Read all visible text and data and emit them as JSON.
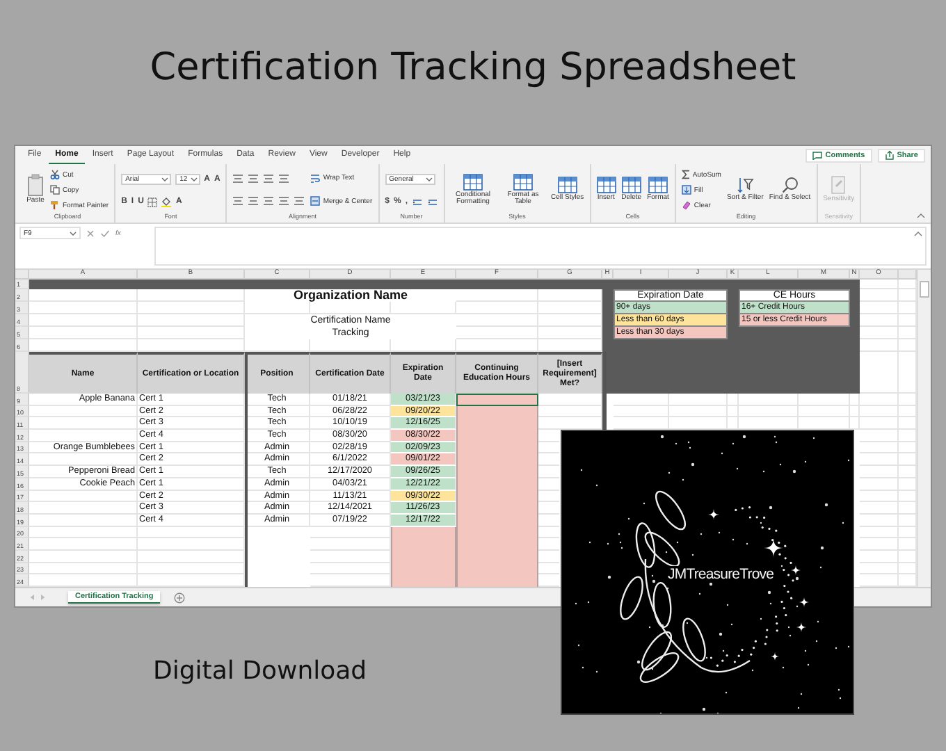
{
  "title": "Certification Tracking Spreadsheet",
  "menu_tabs": [
    {
      "label": "File",
      "selected": false
    },
    {
      "label": "Home",
      "selected": true
    },
    {
      "label": "Insert",
      "selected": false
    },
    {
      "label": "Page Layout",
      "selected": false
    },
    {
      "label": "Formulas",
      "selected": false
    },
    {
      "label": "Data",
      "selected": false
    },
    {
      "label": "Review",
      "selected": false
    },
    {
      "label": "View",
      "selected": false
    },
    {
      "label": "Developer",
      "selected": false
    },
    {
      "label": "Help",
      "selected": false
    }
  ],
  "share_buttons": [
    "Comments",
    "Share"
  ],
  "ribbon": [
    {
      "label": "Clipboard",
      "disabled": false,
      "stacks": [
        [
          [
            {
              "kind": "big",
              "label": "Paste"
            }
          ]
        ],
        [
          [
            {
              "kind": "small",
              "label": "Cut"
            }
          ],
          [
            {
              "kind": "small",
              "label": "Copy"
            }
          ],
          [
            {
              "kind": "small",
              "label": "Format Painter"
            }
          ]
        ]
      ]
    },
    {
      "label": "Font",
      "disabled": false,
      "stacks": [
        [
          [
            {
              "kind": "field",
              "value": "Arial"
            },
            {
              "kind": "field",
              "value": "12"
            },
            {
              "kind": "glyph",
              "label": "A"
            },
            {
              "kind": "glyph",
              "label": "A"
            }
          ],
          [
            {
              "kind": "glyph",
              "label": "B"
            },
            {
              "kind": "glyph",
              "label": "I"
            },
            {
              "kind": "glyph",
              "label": "U"
            },
            {
              "kind": "icon"
            },
            {
              "kind": "icon"
            },
            {
              "kind": "glyph",
              "label": "A"
            }
          ]
        ]
      ]
    },
    {
      "label": "Alignment",
      "disabled": false,
      "stacks": [
        [
          [
            {
              "kind": "icon"
            },
            {
              "kind": "icon"
            },
            {
              "kind": "icon"
            },
            {
              "kind": "icon"
            }
          ],
          [
            {
              "kind": "icon"
            },
            {
              "kind": "icon"
            },
            {
              "kind": "icon"
            },
            {
              "kind": "icon"
            },
            {
              "kind": "icon"
            }
          ]
        ],
        [
          [
            {
              "kind": "small",
              "label": "Wrap Text"
            }
          ],
          [
            {
              "kind": "small",
              "label": "Merge & Center"
            }
          ]
        ]
      ]
    },
    {
      "label": "Number",
      "disabled": false,
      "stacks": [
        [
          [
            {
              "kind": "field",
              "value": "General"
            }
          ],
          [
            {
              "kind": "glyph",
              "label": "$"
            },
            {
              "kind": "glyph",
              "label": "%"
            },
            {
              "kind": "glyph",
              "label": ","
            },
            {
              "kind": "icon"
            },
            {
              "kind": "icon"
            }
          ]
        ]
      ]
    },
    {
      "label": "Styles",
      "disabled": false,
      "stacks": [
        [
          [
            {
              "kind": "big",
              "label": "Conditional Formatting"
            }
          ]
        ],
        [
          [
            {
              "kind": "big",
              "label": "Format as Table"
            }
          ]
        ],
        [
          [
            {
              "kind": "big",
              "label": "Cell Styles"
            }
          ]
        ]
      ]
    },
    {
      "label": "Cells",
      "disabled": false,
      "stacks": [
        [
          [
            {
              "kind": "big",
              "label": "Insert"
            }
          ]
        ],
        [
          [
            {
              "kind": "big",
              "label": "Delete"
            }
          ]
        ],
        [
          [
            {
              "kind": "big",
              "label": "Format"
            }
          ]
        ]
      ]
    },
    {
      "label": "Editing",
      "disabled": false,
      "stacks": [
        [
          [
            {
              "kind": "small",
              "label": "AutoSum"
            }
          ],
          [
            {
              "kind": "small",
              "label": "Fill"
            }
          ],
          [
            {
              "kind": "small",
              "label": "Clear"
            }
          ]
        ],
        [
          [
            {
              "kind": "big",
              "label": "Sort & Filter"
            }
          ]
        ],
        [
          [
            {
              "kind": "big",
              "label": "Find & Select"
            }
          ]
        ]
      ]
    },
    {
      "label": "Sensitivity",
      "disabled": true,
      "stacks": [
        [
          [
            {
              "kind": "big",
              "label": "Sensitivity"
            }
          ]
        ]
      ]
    }
  ],
  "formula_bar": {
    "name_box": "F9",
    "function_label": "fx"
  },
  "column_headers": [
    "A",
    "B",
    "C",
    "D",
    "E",
    "F",
    "G",
    "H",
    "I",
    "J",
    "K",
    "L",
    "M",
    "N",
    "O"
  ],
  "row_numbers": [
    "1",
    "2",
    "3",
    "4",
    "5",
    "6",
    "8",
    "9",
    "10",
    "11",
    "12",
    "13",
    "14",
    "15",
    "16",
    "17",
    "18",
    "19",
    "20",
    "21",
    "22",
    "23",
    "24"
  ],
  "sheet": {
    "org_name": "Organization Name",
    "subtitle_lines": [
      "Certification Name",
      "Tracking"
    ],
    "headers": [
      "Name",
      "Certification or Location",
      "Position",
      "Certification Date",
      "Expiration Date",
      "Continuing Education Hours",
      "[Insert Requirement] Met?"
    ],
    "rows": [
      {
        "name": "Apple Banana",
        "cert": "Cert 1",
        "position": "Tech",
        "cert_date": "01/18/21",
        "exp_date": "03/21/23",
        "color": "#bfe1c9"
      },
      {
        "cert": "Cert 2",
        "position": "Tech",
        "cert_date": "06/28/22",
        "exp_date": "09/20/22",
        "color": "#fde49a"
      },
      {
        "cert": "Cert 3",
        "position": "Tech",
        "cert_date": "10/10/19",
        "exp_date": "12/16/25",
        "color": "#bfe1c9"
      },
      {
        "cert": "Cert 4",
        "position": "Tech",
        "cert_date": "08/30/20",
        "exp_date": "08/30/22",
        "color": "#f4c6c0"
      },
      {
        "name": "Orange Bumblebees",
        "cert": "Cert 1",
        "position": "Admin",
        "cert_date": "02/28/19",
        "exp_date": "02/09/23",
        "color": "#bfe1c9"
      },
      {
        "cert": "Cert 2",
        "position": "Admin",
        "cert_date": "6/1/2022",
        "exp_date": "09/01/22",
        "color": "#f4c6c0"
      },
      {
        "name": "Pepperoni Bread",
        "cert": "Cert 1",
        "position": "Tech",
        "cert_date": "12/17/2020",
        "exp_date": "09/26/25",
        "color": "#bfe1c9"
      },
      {
        "name": "Cookie Peach",
        "cert": "Cert 1",
        "position": "Admin",
        "cert_date": "04/03/21",
        "exp_date": "12/21/22",
        "color": "#bfe1c9"
      },
      {
        "cert": "Cert 2",
        "position": "Admin",
        "cert_date": "11/13/21",
        "exp_date": "09/30/22",
        "color": "#fde49a"
      },
      {
        "cert": "Cert 3",
        "position": "Admin",
        "cert_date": "12/14/2021",
        "exp_date": "11/26/23",
        "color": "#bfe1c9"
      },
      {
        "cert": "Cert 4",
        "position": "Admin",
        "cert_date": "07/19/22",
        "exp_date": "12/17/22",
        "color": "#bfe1c9"
      }
    ]
  },
  "legends": [
    {
      "title": "Expiration Date",
      "items": [
        {
          "label": "90+ days",
          "color": "#bfe1c9"
        },
        {
          "label": "Less than 60 days",
          "color": "#fde49a"
        },
        {
          "label": "Less than 30 days",
          "color": "#f4c6c0"
        }
      ]
    },
    {
      "title": "CE Hours",
      "items": [
        {
          "label": "16+ Credit Hours",
          "color": "#bfe1c9"
        },
        {
          "label": "15 or less Credit Hours",
          "color": "#f4c6c0"
        }
      ]
    }
  ],
  "sheet_tabs": [
    {
      "label": "Certification Tracking",
      "selected": true
    }
  ],
  "logo": {
    "text": "JMTreasureTrove"
  },
  "footer": "Digital Download"
}
